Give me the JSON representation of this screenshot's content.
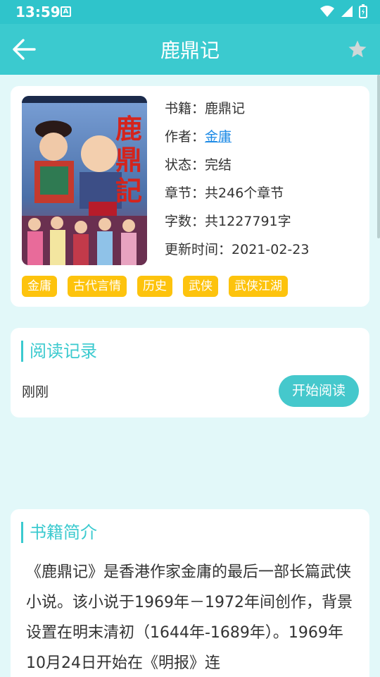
{
  "status": {
    "time": "13:59",
    "a_badge": "A"
  },
  "appbar": {
    "title": "鹿鼎记"
  },
  "book": {
    "cover_alt": "鹿鼎記",
    "info": [
      {
        "label": "书籍：",
        "value": "鹿鼎记",
        "link": false
      },
      {
        "label": "作者：",
        "value": "金庸",
        "link": true
      },
      {
        "label": "状态：",
        "value": "完结",
        "link": false
      },
      {
        "label": "章节：",
        "value": "共246个章节",
        "link": false
      },
      {
        "label": "字数：",
        "value": "共1227791字",
        "link": false
      },
      {
        "label": "更新时间：",
        "value": "2021-02-23",
        "link": false
      }
    ],
    "tags": [
      "金庸",
      "古代言情",
      "历史",
      "武侠",
      "武侠江湖"
    ]
  },
  "reading": {
    "title": "阅读记录",
    "time": "刚刚",
    "start_label": "开始阅读"
  },
  "intro": {
    "title": "书籍简介",
    "text": "《鹿鼎记》是香港作家金庸的最后一部长篇武侠小说。该小说于1969年－1972年间创作，背景设置在明末清初（1644年-1689年）。1969年10月24日开始在《明报》连"
  },
  "colors": {
    "accent": "#3bcacf",
    "tag": "#fdc30d",
    "link": "#1e8be6",
    "background": "#e2f8f9"
  }
}
